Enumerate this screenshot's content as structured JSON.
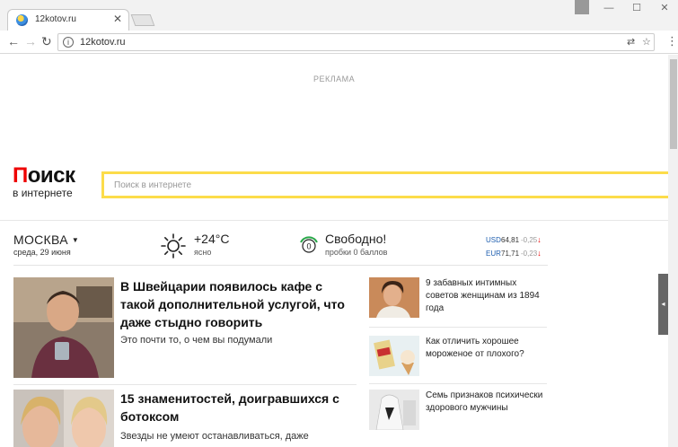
{
  "browser": {
    "tab_title": "12kotov.ru",
    "tab_close": "✕",
    "url": "12kotov.ru",
    "window_minimize": "—",
    "window_maximize": "☐",
    "window_close": "✕"
  },
  "page": {
    "ad_label": "РЕКЛАМА",
    "logo_main_first": "П",
    "logo_main_rest": "оиск",
    "logo_sub": "в интернете",
    "search_placeholder": "Поиск в интернете"
  },
  "info": {
    "city": "МОСКВА",
    "date": "среда, 29 июня",
    "temperature": "+24°C",
    "condition": "ясно",
    "traffic_score": "0",
    "traffic_status": "Свободно!",
    "traffic_sub": "пробки 0 баллов",
    "rates": [
      {
        "currency": "USD",
        "value": "64,81",
        "change": "-0,25"
      },
      {
        "currency": "EUR",
        "value": "71,71",
        "change": "-0,23"
      }
    ]
  },
  "news_main": [
    {
      "title": "В Швейцарии появилось кафе с такой дополнительной услугой, что даже стыдно говорить",
      "desc": "Это почти то, о чем вы подумали"
    },
    {
      "title": "15 знаменитостей, доигравшихся с ботоксом",
      "desc": "Звезды не умеют останавливаться, даже"
    }
  ],
  "news_side": [
    {
      "title": "9 забавных интимных советов женщинам из 1894 года"
    },
    {
      "title": "Как отличить хорошее мороженое от плохого?"
    },
    {
      "title": "Семь признаков психически здорового мужчины"
    }
  ],
  "colors": {
    "accent_red": "#e00000",
    "search_border": "#fcdc4a",
    "rates_currency": "#2060b0"
  }
}
